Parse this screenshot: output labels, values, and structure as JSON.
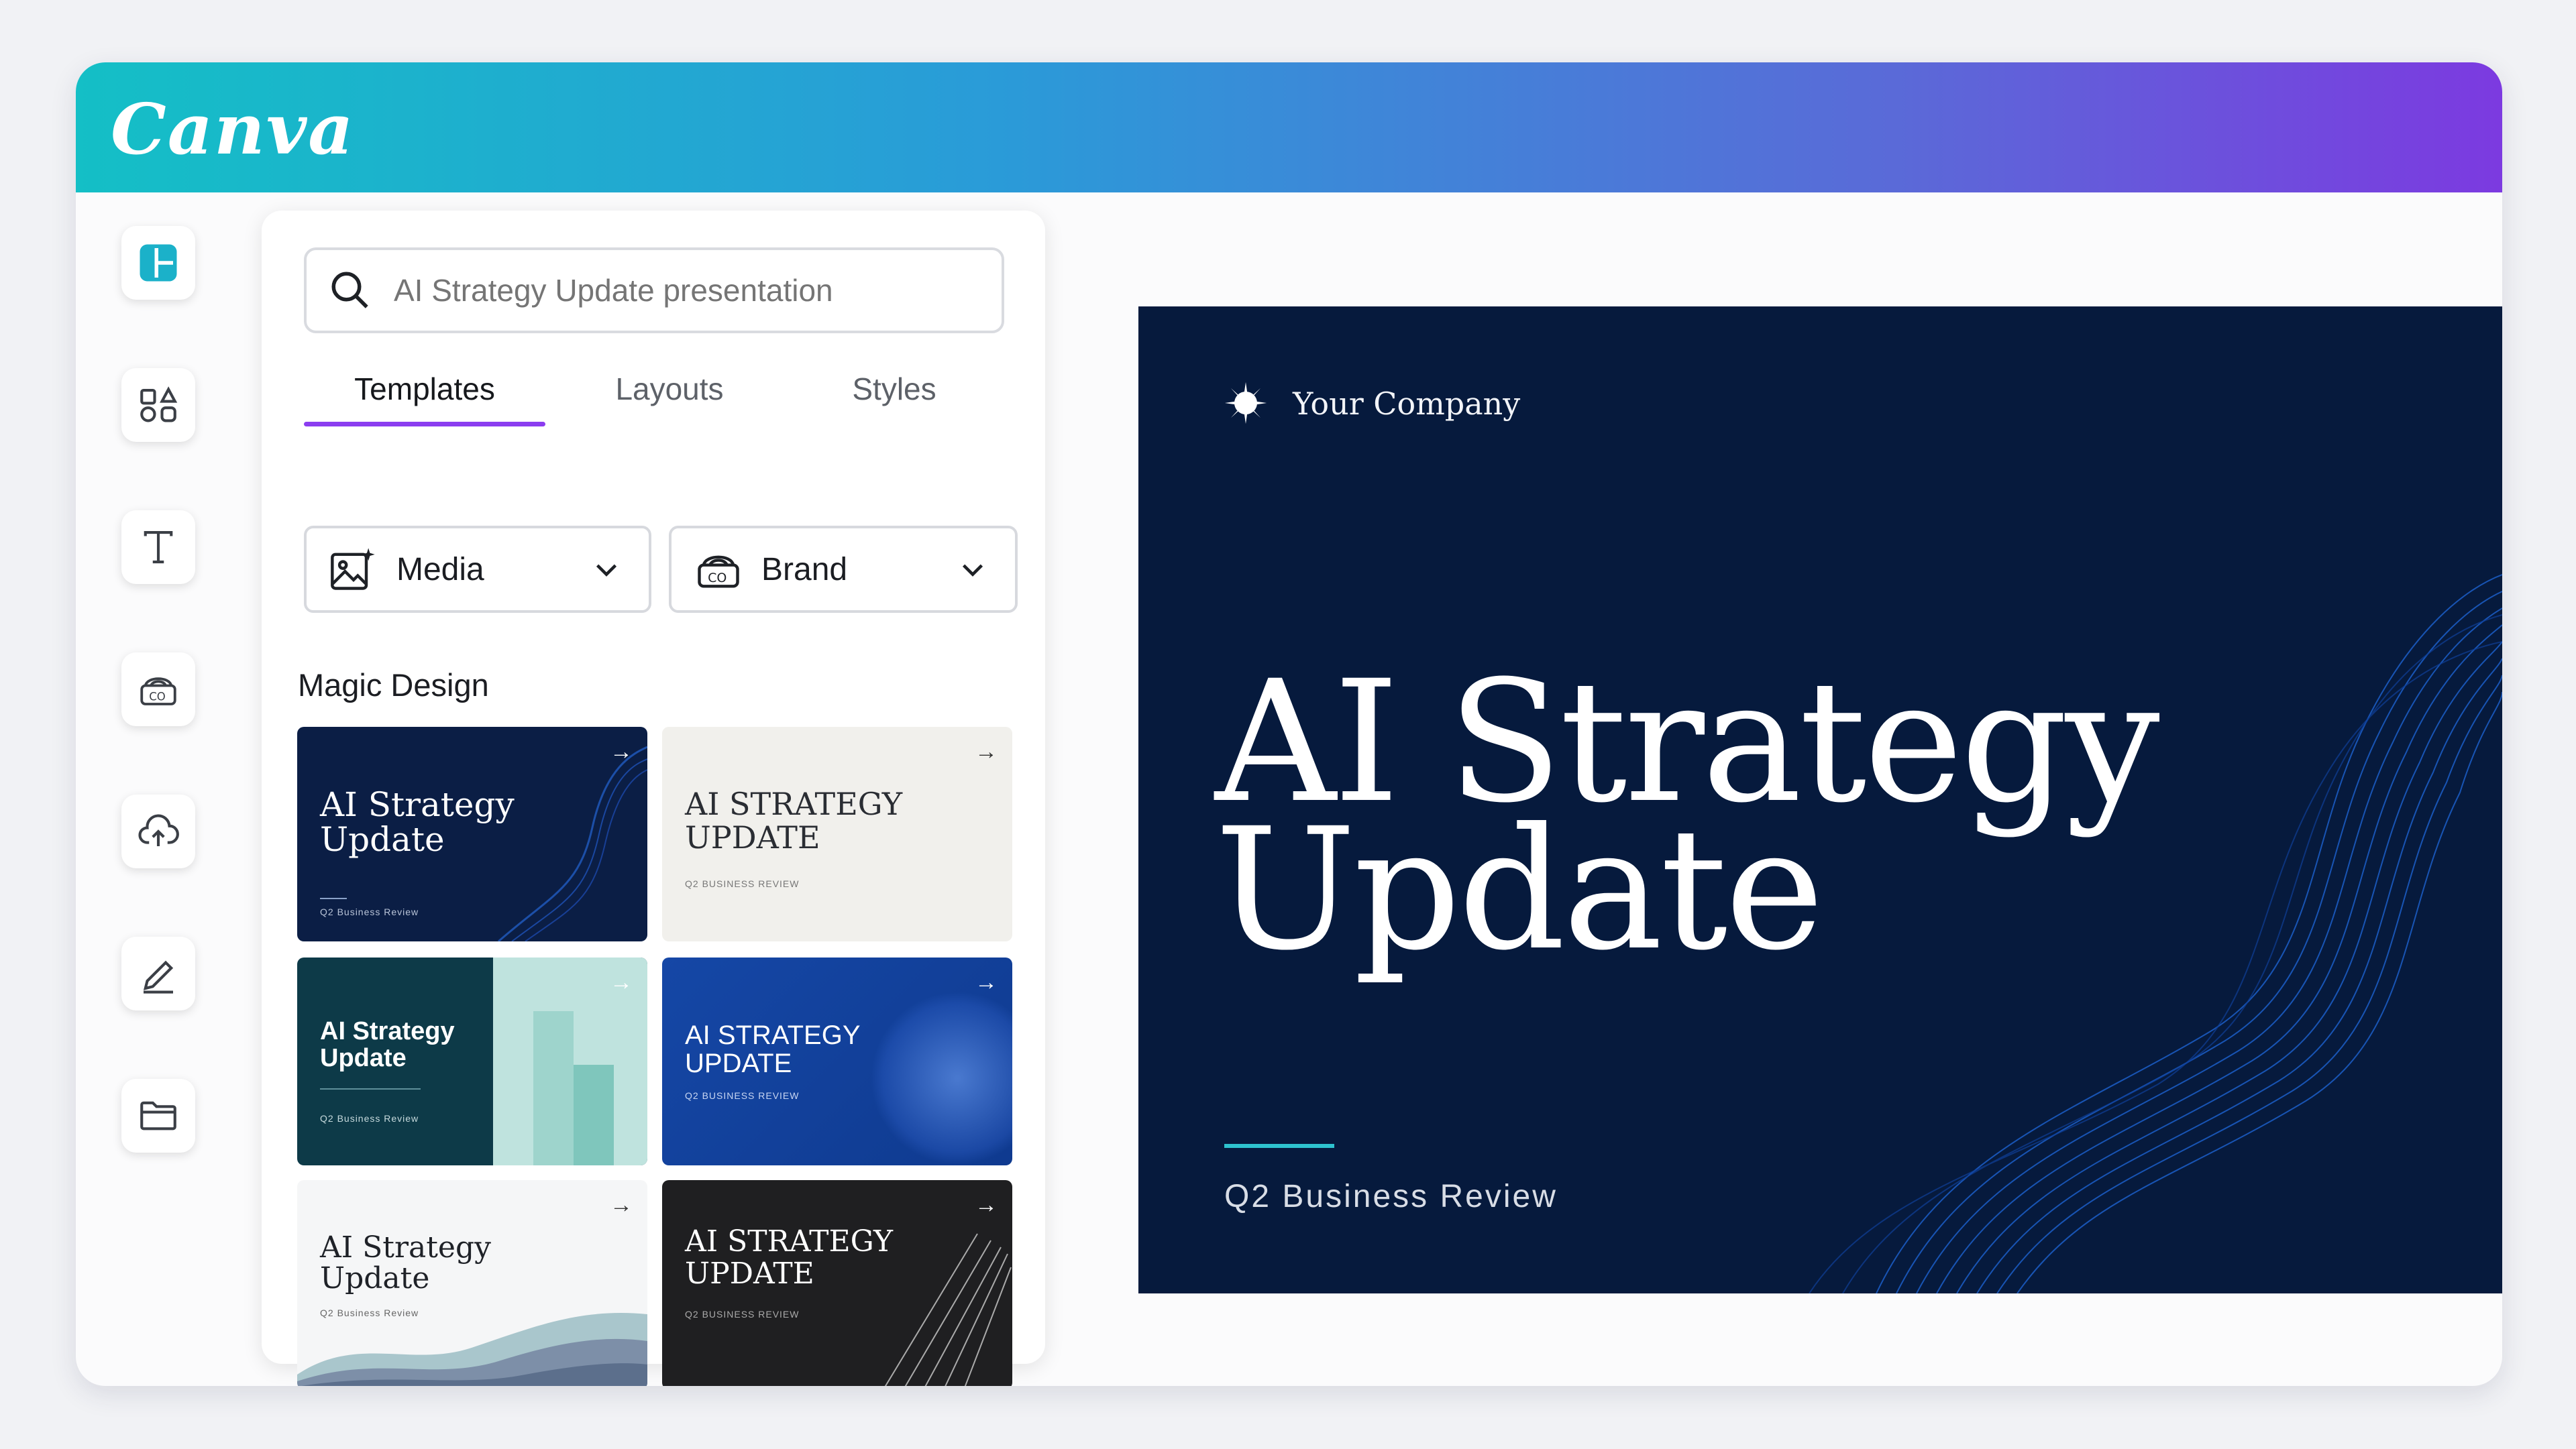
{
  "app": {
    "name": "Canva"
  },
  "search": {
    "placeholder": "AI Strategy Update presentation"
  },
  "tabs": [
    {
      "label": "Templates",
      "active": true
    },
    {
      "label": "Layouts",
      "active": false
    },
    {
      "label": "Styles",
      "active": false
    }
  ],
  "filters": {
    "media": {
      "label": "Media",
      "icon": "image-sparkle-icon"
    },
    "brand": {
      "label": "Brand",
      "icon": "brand-kit-icon"
    }
  },
  "magic_design": {
    "title": "Magic Design",
    "templates": [
      {
        "title_line1": "AI Strategy",
        "title_line2": "Update",
        "subtitle": "Q2 Business Review"
      },
      {
        "title_line1": "AI STRATEGY",
        "title_line2": "UPDATE",
        "subtitle": "Q2 BUSINESS REVIEW"
      },
      {
        "title_line1": "AI Strategy",
        "title_line2": "Update",
        "subtitle": "Q2 Business Review"
      },
      {
        "title_line1": "AI STRATEGY",
        "title_line2": "UPDATE",
        "subtitle": "Q2 BUSINESS REVIEW"
      },
      {
        "title_line1": "AI Strategy",
        "title_line2": "Update",
        "subtitle": "Q2 Business Review"
      },
      {
        "title_line1": "AI STRATEGY",
        "title_line2": "UPDATE",
        "subtitle": "Q2 BUSINESS REVIEW"
      }
    ]
  },
  "rail": [
    {
      "icon": "design-icon",
      "active": true
    },
    {
      "icon": "elements-icon"
    },
    {
      "icon": "text-icon"
    },
    {
      "icon": "brand-icon"
    },
    {
      "icon": "uploads-icon"
    },
    {
      "icon": "draw-icon"
    },
    {
      "icon": "projects-icon"
    }
  ],
  "preview": {
    "company": "Your Company",
    "title_line1": "AI Strategy",
    "title_line2": "Update",
    "subtitle": "Q2 Business Review"
  },
  "colors": {
    "accent": "#8b3df0",
    "brand_teal": "#14bfc6",
    "slide_bg": "#061a3d"
  }
}
